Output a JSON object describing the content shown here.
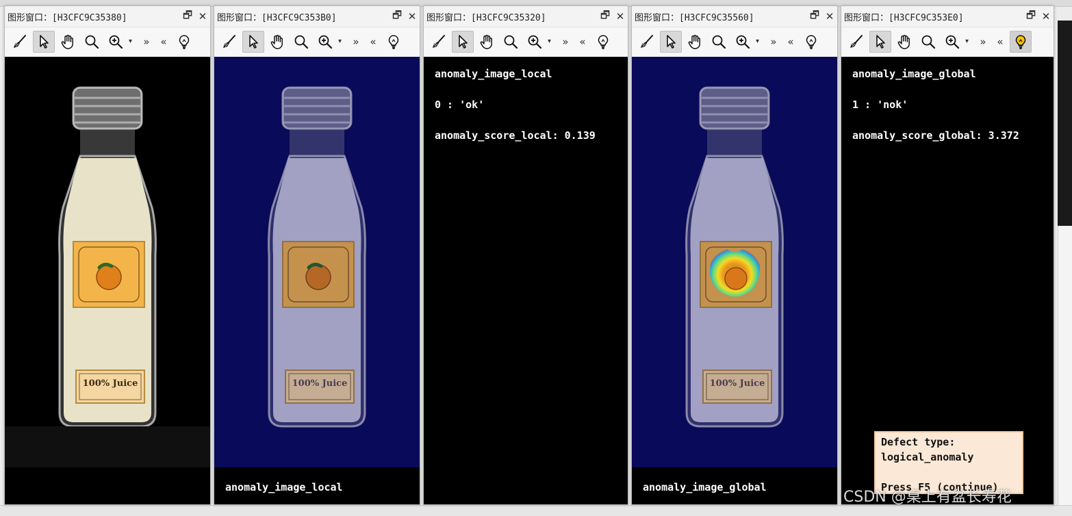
{
  "windows": [
    {
      "title": "图形窗口：[H3CFC9C35380]",
      "canvas_texts": [],
      "bottom_label": "",
      "lightbulb_lit": false
    },
    {
      "title": "图形窗口：[H3CFC9C353B0]",
      "canvas_texts": [],
      "bottom_label": "anomaly_image_local",
      "lightbulb_lit": false
    },
    {
      "title": "图形窗口：[H3CFC9C35320]",
      "canvas_texts": [
        "anomaly_image_local",
        "0 : 'ok'",
        "anomaly_score_local: 0.139"
      ],
      "bottom_label": "",
      "lightbulb_lit": false
    },
    {
      "title": "图形窗口：[H3CFC9C35560]",
      "canvas_texts": [],
      "bottom_label": "anomaly_image_global",
      "lightbulb_lit": false
    },
    {
      "title": "图形窗口：[H3CFC9C353E0]",
      "canvas_texts": [
        "anomaly_image_global",
        "1 : 'nok'",
        "anomaly_score_global: 3.372"
      ],
      "bottom_label": "",
      "lightbulb_lit": true
    }
  ],
  "toolbar": {
    "restore_glyph": "🗗",
    "close_glyph": "✕",
    "forward_glyph": "»",
    "back_glyph": "«",
    "dropdown_glyph": "▾",
    "icons": [
      "broom-icon",
      "pointer-icon",
      "hand-icon",
      "magnifier-icon",
      "zoom-in-icon",
      "lightbulb-icon"
    ]
  },
  "bottle_label_text": "100% Juice",
  "defect_box": {
    "line1": "Defect type:",
    "line2": "logical_anomaly",
    "line3": "Press F5 (continue)"
  },
  "watermark": "CSDN @桌上有盆长寿花",
  "colors": {
    "heatmap_blue": "#0a0a5a",
    "canvas_black": "#000000",
    "defect_bg": "#fbe8d6",
    "lightbulb_lit": "#f5c300"
  }
}
